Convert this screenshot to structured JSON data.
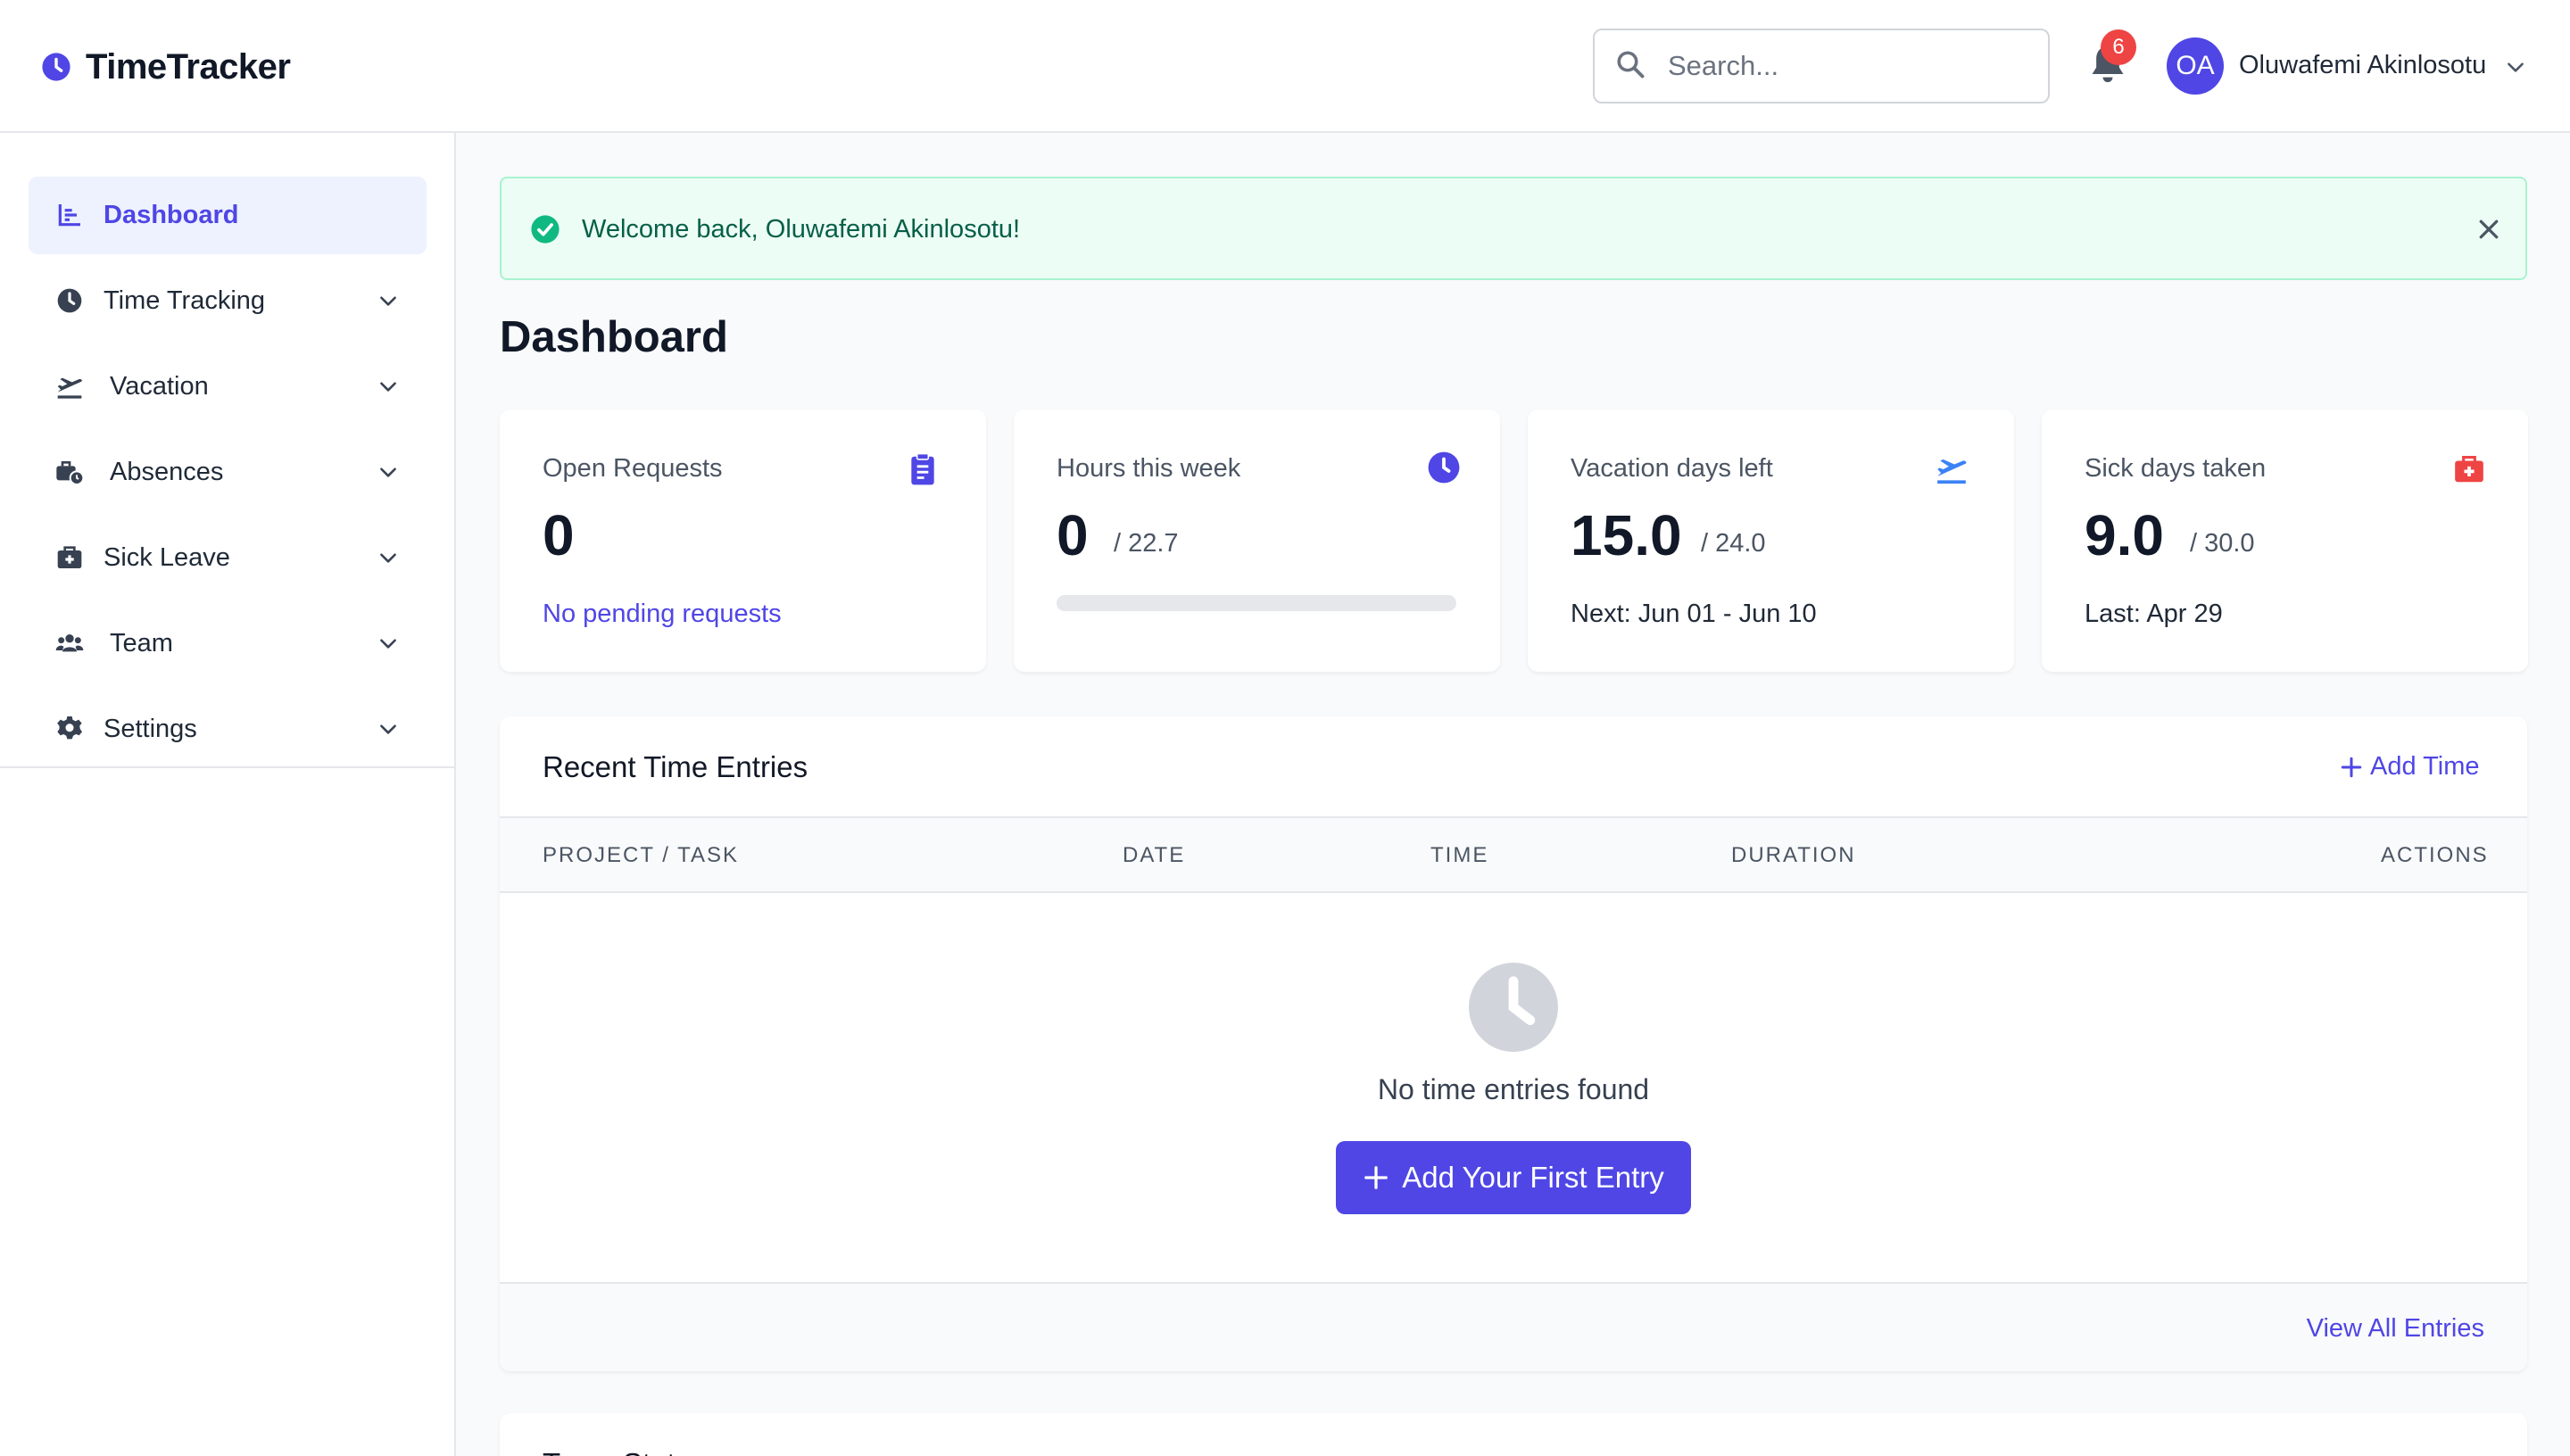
{
  "header": {
    "brand": "TimeTracker",
    "search_placeholder": "Search...",
    "notification_count": "6",
    "user_initials": "OA",
    "user_name": "Oluwafemi Akinlosotu"
  },
  "sidebar": {
    "items": [
      {
        "label": "Dashboard",
        "icon": "chart-icon",
        "active": true
      },
      {
        "label": "Time Tracking",
        "icon": "clock-icon"
      },
      {
        "label": "Vacation",
        "icon": "plane-icon"
      },
      {
        "label": "Absences",
        "icon": "briefcase-clock-icon"
      },
      {
        "label": "Sick Leave",
        "icon": "medkit-icon"
      },
      {
        "label": "Team",
        "icon": "users-icon"
      },
      {
        "label": "Settings",
        "icon": "gear-icon"
      }
    ]
  },
  "alert": {
    "message": "Welcome back, Oluwafemi Akinlosotu!"
  },
  "page_title": "Dashboard",
  "stats": [
    {
      "label": "Open Requests",
      "value": "0",
      "sub": "No pending requests",
      "icon": "clipboard-icon"
    },
    {
      "label": "Hours this week",
      "value": "0",
      "total": "/ 22.7",
      "progress": 0,
      "icon": "clock-icon"
    },
    {
      "label": "Vacation days left",
      "value": "15.0",
      "total": "/ 24.0",
      "sub": "Next: Jun 01 - Jun 10",
      "icon": "plane-icon"
    },
    {
      "label": "Sick days taken",
      "value": "9.0",
      "total": "/ 30.0",
      "sub": "Last: Apr 29",
      "icon": "medkit-icon"
    }
  ],
  "entries": {
    "title": "Recent Time Entries",
    "add_label": "Add Time",
    "columns": [
      "PROJECT / TASK",
      "DATE",
      "TIME",
      "DURATION",
      "ACTIONS"
    ],
    "empty_text": "No time entries found",
    "first_entry_label": "Add Your First Entry",
    "view_all_label": "View All Entries"
  },
  "team": {
    "title": "Team Status"
  },
  "colors": {
    "accent": "#4f46e5",
    "success": "#10b981",
    "danger": "#ef4444"
  }
}
